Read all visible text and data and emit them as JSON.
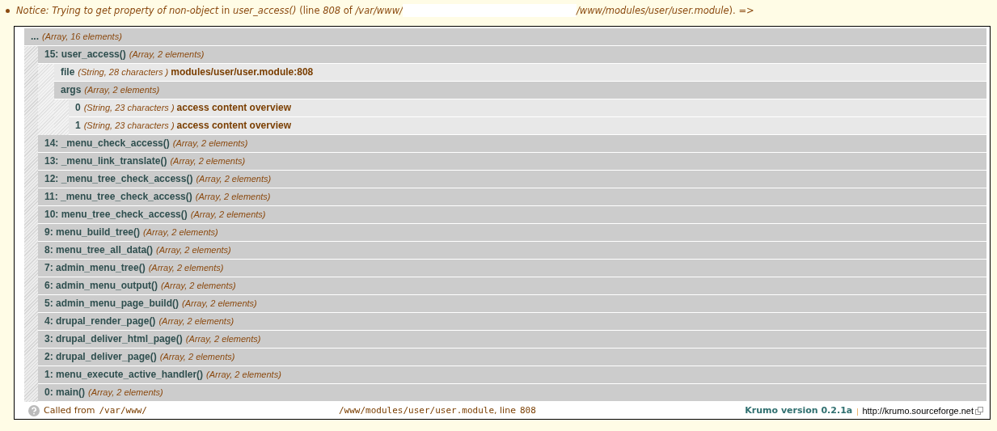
{
  "notice": {
    "text_start": "*Notice: Trying to get property of non-object* in *user_access()* (line *808* of */var/www/*",
    "text_end": "*/www/modules/user/user.module*). =>"
  },
  "dump": {
    "root": {
      "kind": "array",
      "name": "...",
      "info": "(Array, 16 elements)",
      "children": [
        {
          "kind": "array",
          "name": "15: user_access()",
          "info": "(Array, 2 elements)",
          "children": [
            {
              "kind": "string",
              "name": "file",
              "info": "(String, 28 characters )",
              "value": "modules/user/user.module:808"
            },
            {
              "kind": "array",
              "name": "args",
              "info": "(Array, 2 elements)",
              "children": [
                {
                  "kind": "string",
                  "name": "0",
                  "info": "(String, 23 characters )",
                  "value": "access content overview"
                },
                {
                  "kind": "string",
                  "name": "1",
                  "info": "(String, 23 characters )",
                  "value": "access content overview"
                }
              ]
            }
          ]
        },
        {
          "kind": "array",
          "name": "14: _menu_check_access()",
          "info": "(Array, 2 elements)"
        },
        {
          "kind": "array",
          "name": "13: _menu_link_translate()",
          "info": "(Array, 2 elements)"
        },
        {
          "kind": "array",
          "name": "12: _menu_tree_check_access()",
          "info": "(Array, 2 elements)"
        },
        {
          "kind": "array",
          "name": "11: _menu_tree_check_access()",
          "info": "(Array, 2 elements)"
        },
        {
          "kind": "array",
          "name": "10: menu_tree_check_access()",
          "info": "(Array, 2 elements)"
        },
        {
          "kind": "array",
          "name": "9: menu_build_tree()",
          "info": "(Array, 2 elements)"
        },
        {
          "kind": "array",
          "name": "8: menu_tree_all_data()",
          "info": "(Array, 2 elements)"
        },
        {
          "kind": "array",
          "name": "7: admin_menu_tree()",
          "info": "(Array, 2 elements)"
        },
        {
          "kind": "array",
          "name": "6: admin_menu_output()",
          "info": "(Array, 2 elements)"
        },
        {
          "kind": "array",
          "name": "5: admin_menu_page_build()",
          "info": "(Array, 2 elements)"
        },
        {
          "kind": "array",
          "name": "4: drupal_render_page()",
          "info": "(Array, 2 elements)"
        },
        {
          "kind": "array",
          "name": "3: drupal_deliver_html_page()",
          "info": "(Array, 2 elements)"
        },
        {
          "kind": "array",
          "name": "2: drupal_deliver_page()",
          "info": "(Array, 2 elements)"
        },
        {
          "kind": "array",
          "name": "1: menu_execute_active_handler()",
          "info": "(Array, 2 elements)"
        },
        {
          "kind": "array",
          "name": "0: main()",
          "info": "(Array, 2 elements)"
        }
      ]
    }
  },
  "footer": {
    "label": "Called from",
    "path_start": "/var/www/",
    "path_end": "/www/modules/user/user.module",
    "line_label": ", line",
    "line": "808",
    "version": "Krumo version 0.2.1a",
    "separator": "|",
    "link": "http://krumo.sourceforge.net"
  }
}
